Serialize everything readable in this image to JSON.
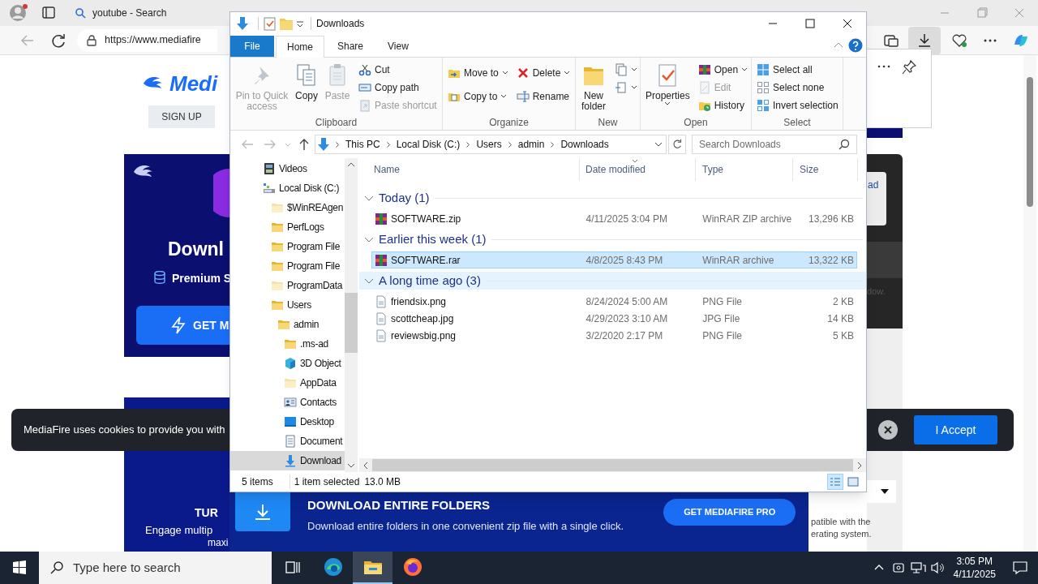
{
  "browser": {
    "tabs": [
      {
        "label": "youtube - Search",
        "selected": false
      }
    ],
    "address": "https://www.mediafire",
    "downloads_active": true,
    "page": {
      "logo": "Medi",
      "sign_up": "SIGN UP",
      "ad_top": {
        "heading": "Downl",
        "feature": "Premium S",
        "button": "GET M"
      },
      "ad_bottom": {
        "heading": "TUR",
        "lines": [
          "Engage multip",
          "maxi"
        ]
      },
      "dialog_link": "ad",
      "note": "dow.",
      "compat_lines": [
        "patible with the",
        "erating system."
      ],
      "cookie": {
        "text": "MediaFire uses cookies to provide you with",
        "accept": "I Accept"
      },
      "promo": {
        "title": "DOWNLOAD ENTIRE FOLDERS",
        "text": "Download entire folders in one convenient zip file with a single click.",
        "button": "GET MEDIAFIRE PRO"
      }
    }
  },
  "explorer": {
    "title": "Downloads",
    "ribbon_tabs": [
      {
        "label": "File",
        "kind": "file",
        "selected": false
      },
      {
        "label": "Home",
        "kind": "tab",
        "selected": true
      },
      {
        "label": "Share",
        "kind": "tab",
        "selected": false
      },
      {
        "label": "View",
        "kind": "tab",
        "selected": false
      }
    ],
    "ribbon_groups": [
      {
        "label": "Clipboard",
        "columns": [
          {
            "kind": "large",
            "items": [
              {
                "label": "Pin to Quick access",
                "disabled": true,
                "dropdown": false
              },
              {
                "label": "Copy",
                "disabled": false,
                "dropdown": false
              },
              {
                "label": "Paste",
                "disabled": true,
                "dropdown": false
              }
            ]
          },
          {
            "kind": "small",
            "items": [
              {
                "label": "Cut",
                "disabled": false,
                "dropdown": false
              },
              {
                "label": "Copy path",
                "disabled": false,
                "dropdown": false
              },
              {
                "label": "Paste shortcut",
                "disabled": true,
                "dropdown": false
              }
            ]
          }
        ]
      },
      {
        "label": "Organize",
        "columns": [
          {
            "kind": "small",
            "items": [
              {
                "label": "Move to",
                "disabled": false,
                "dropdown": true
              },
              {
                "label": "Copy to",
                "disabled": false,
                "dropdown": true
              }
            ]
          },
          {
            "kind": "small",
            "items": [
              {
                "label": "Delete",
                "disabled": false,
                "dropdown": true
              },
              {
                "label": "Rename",
                "disabled": false,
                "dropdown": false
              }
            ]
          }
        ]
      },
      {
        "label": "New",
        "columns": [
          {
            "kind": "large",
            "items": [
              {
                "label": "New folder",
                "disabled": false,
                "dropdown": false
              }
            ]
          },
          {
            "kind": "small",
            "items": [
              {
                "disabled": false,
                "dropdown": true
              },
              {
                "disabled": false,
                "dropdown": true
              }
            ]
          }
        ]
      },
      {
        "label": "Open",
        "columns": [
          {
            "kind": "large",
            "items": [
              {
                "label": "Properties",
                "disabled": false,
                "dropdown": true
              }
            ]
          },
          {
            "kind": "small",
            "items": [
              {
                "label": "Open",
                "disabled": false,
                "dropdown": true
              },
              {
                "label": "Edit",
                "disabled": true,
                "dropdown": false
              },
              {
                "label": "History",
                "disabled": false,
                "dropdown": false
              }
            ]
          }
        ]
      },
      {
        "label": "Select",
        "columns": [
          {
            "kind": "small",
            "items": [
              {
                "label": "Select all",
                "disabled": false,
                "dropdown": false
              },
              {
                "label": "Select none",
                "disabled": false,
                "dropdown": false
              },
              {
                "label": "Invert selection",
                "disabled": false,
                "dropdown": false
              }
            ]
          }
        ]
      }
    ],
    "breadcrumb": [
      "This PC",
      "Local Disk (C:)",
      "Users",
      "admin",
      "Downloads"
    ],
    "search_placeholder": "Search Downloads",
    "nav": [
      {
        "label": "Videos",
        "kind": "videos",
        "hidden": false,
        "selected": false
      },
      {
        "label": "Local Disk (C:)",
        "kind": "drive",
        "hidden": false,
        "selected": false,
        "children": [
          {
            "label": "$WinREAgen",
            "kind": "folder",
            "hidden": true,
            "selected": false
          },
          {
            "label": "PerfLogs",
            "kind": "folder",
            "hidden": false,
            "selected": false
          },
          {
            "label": "Program File",
            "kind": "folder",
            "hidden": false,
            "selected": false
          },
          {
            "label": "Program File",
            "kind": "folder",
            "hidden": false,
            "selected": false
          },
          {
            "label": "ProgramData",
            "kind": "folder",
            "hidden": true,
            "selected": false
          },
          {
            "label": "Users",
            "kind": "folder",
            "hidden": false,
            "selected": false,
            "children": [
              {
                "label": "admin",
                "kind": "folder",
                "hidden": false,
                "selected": false,
                "children": [
                  {
                    "label": ".ms-ad",
                    "kind": "folder",
                    "hidden": false,
                    "selected": false
                  },
                  {
                    "label": "3D Object",
                    "kind": "objects",
                    "hidden": false,
                    "selected": false
                  },
                  {
                    "label": "AppData",
                    "kind": "folder",
                    "hidden": true,
                    "selected": false
                  },
                  {
                    "label": "Contacts",
                    "kind": "contacts",
                    "hidden": false,
                    "selected": false
                  },
                  {
                    "label": "Desktop",
                    "kind": "desktop",
                    "hidden": false,
                    "selected": false
                  },
                  {
                    "label": "Document",
                    "kind": "documents",
                    "hidden": false,
                    "selected": false
                  },
                  {
                    "label": "Download",
                    "kind": "downloads",
                    "hidden": false,
                    "selected": true
                  }
                ]
              }
            ]
          }
        ]
      }
    ],
    "columns": [
      {
        "label": "Name",
        "sorted": false
      },
      {
        "label": "Date modified",
        "sorted": true
      },
      {
        "label": "Type",
        "sorted": false
      },
      {
        "label": "Size",
        "sorted": false
      }
    ],
    "groups": [
      {
        "label": "Today (1)",
        "highlighted": false,
        "rows": [
          {
            "name": "SOFTWARE.zip",
            "date": "4/11/2025 3:04 PM",
            "type": "WinRAR ZIP archive",
            "size": "13,296 KB",
            "kind": "archive",
            "selected": false
          }
        ]
      },
      {
        "label": "Earlier this week (1)",
        "highlighted": false,
        "rows": [
          {
            "name": "SOFTWARE.rar",
            "date": "4/8/2025 8:43 PM",
            "type": "WinRAR archive",
            "size": "13,322 KB",
            "kind": "archive",
            "selected": true
          }
        ]
      },
      {
        "label": "A long time ago (3)",
        "highlighted": true,
        "rows": [
          {
            "name": "friendsix.png",
            "date": "8/24/2024 5:00 AM",
            "type": "PNG File",
            "size": "2 KB",
            "kind": "image",
            "selected": false
          },
          {
            "name": "scottcheap.jpg",
            "date": "4/29/2023 3:10 AM",
            "type": "JPG File",
            "size": "14 KB",
            "kind": "image",
            "selected": false
          },
          {
            "name": "reviewsbig.png",
            "date": "3/2/2020 2:17 PM",
            "type": "PNG File",
            "size": "5 KB",
            "kind": "image",
            "selected": false
          }
        ]
      }
    ],
    "status": {
      "count": "5 items",
      "selection": "1 item selected",
      "size": "13.0 MB"
    },
    "views": [
      {
        "kind": "details",
        "selected": true
      },
      {
        "kind": "large",
        "selected": false
      }
    ]
  },
  "taskbar": {
    "search_placeholder": "Type here to search",
    "apps": [
      {
        "kind": "edge",
        "active": false
      },
      {
        "kind": "explorer",
        "active": true
      },
      {
        "kind": "firefox",
        "active": false
      }
    ],
    "time": "3:05 PM",
    "date": "4/11/2025"
  }
}
